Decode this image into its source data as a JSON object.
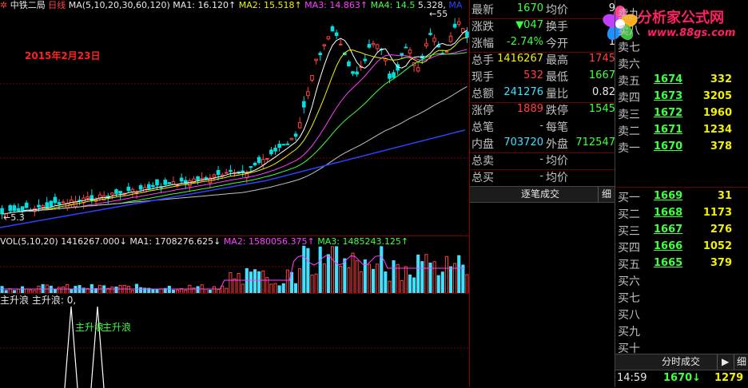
{
  "header": {
    "stock_name": "中铁二局",
    "period": "日线",
    "ma_params": "MA(5,10,20,30,60,120)",
    "ma1": "MA1: 16.120↑",
    "ma2": "MA2: 15.518↑",
    "ma3": "MA3: 14.863↑",
    "ma4": "MA4: 14.5",
    "ma5": "5.328,",
    "ma6": "MA",
    "peak_label": "←55",
    "low_label": "←5.3"
  },
  "date_label": "2015年2月23日",
  "volume": {
    "params": "VOL(5,10,20)",
    "vol": "1416267.000↓",
    "ma1": "MA1: 1708276.625↓",
    "ma2": "MA2: 1580056.375↑",
    "ma3": "MA3: 1485243.125↑"
  },
  "indicator": {
    "name": "主升浪",
    "value": "主升浪: 0,",
    "signal1": "主升浪",
    "signal2": "主升浪"
  },
  "quote": {
    "rows": [
      {
        "l1": "最新",
        "v1": "1670",
        "l2": "均价",
        "v2": "9"
      },
      {
        "l1": "涨跌",
        "v1": "▼047",
        "l2": "换手",
        "v2": "9"
      },
      {
        "l1": "涨幅",
        "v1": "-2.74%",
        "l2": "今开",
        "v2": "1"
      },
      {
        "l1": "总手",
        "v1": "1416267",
        "l2": "最高",
        "v2": "1745"
      },
      {
        "l1": "现手",
        "v1": "532",
        "l2": "最低",
        "v2": "1667"
      },
      {
        "l1": "总额",
        "v1": "241276",
        "l2": "量比",
        "v2": "0.82"
      },
      {
        "l1": "涨停",
        "v1": "1889",
        "l2": "跌停",
        "v2": "1545"
      },
      {
        "l1": "总笔",
        "v1": "-",
        "l2": "每笔",
        "v2": ""
      },
      {
        "l1": "内盘",
        "v1": "703720",
        "l2": "外盘",
        "v2": "712547"
      },
      {
        "l1": "总卖",
        "v1": "-",
        "l2": "均价",
        "v2": ""
      },
      {
        "l1": "总买",
        "v1": "-",
        "l2": "均价",
        "v2": ""
      }
    ],
    "tick_tab": "逐笔成交",
    "tick_btn": "细"
  },
  "orderbook": {
    "sell": [
      {
        "label": "卖九",
        "price": "",
        "vol": ""
      },
      {
        "label": "卖八",
        "price": "",
        "vol": ""
      },
      {
        "label": "卖七",
        "price": "",
        "vol": ""
      },
      {
        "label": "卖六",
        "price": "",
        "vol": ""
      },
      {
        "label": "卖五",
        "price": "1674",
        "vol": "332"
      },
      {
        "label": "卖四",
        "price": "1673",
        "vol": "3205"
      },
      {
        "label": "卖三",
        "price": "1672",
        "vol": "1960"
      },
      {
        "label": "卖二",
        "price": "1671",
        "vol": "1234"
      },
      {
        "label": "卖一",
        "price": "1670",
        "vol": "378"
      }
    ],
    "buy": [
      {
        "label": "买一",
        "price": "1669",
        "vol": "31"
      },
      {
        "label": "买二",
        "price": "1668",
        "vol": "1173"
      },
      {
        "label": "买三",
        "price": "1667",
        "vol": "276"
      },
      {
        "label": "买四",
        "price": "1666",
        "vol": "1052"
      },
      {
        "label": "买五",
        "price": "1665",
        "vol": "379"
      },
      {
        "label": "买六",
        "price": "",
        "vol": ""
      },
      {
        "label": "买七",
        "price": "",
        "vol": ""
      },
      {
        "label": "买八",
        "price": "",
        "vol": ""
      },
      {
        "label": "买九",
        "price": "",
        "vol": ""
      },
      {
        "label": "买十",
        "price": "",
        "vol": ""
      }
    ],
    "timeshare_tab": "分时成交",
    "play_btn": "▶",
    "detail_btn": "细"
  },
  "last_trade": {
    "time": "14:59",
    "price": "1670↓",
    "vol": "1279"
  },
  "watermark": {
    "brand": "分析家公式网",
    "url": "www.88gs.com"
  },
  "colors": {
    "up": "#ff4040",
    "down": "#40ff40",
    "ma1": "#ffffff",
    "ma2": "#f0f000",
    "ma3": "#ff40ff",
    "ma4": "#40ff40",
    "ma5": "#c0c0c0",
    "ma6": "#3040ff",
    "grid": "#7a0000"
  }
}
